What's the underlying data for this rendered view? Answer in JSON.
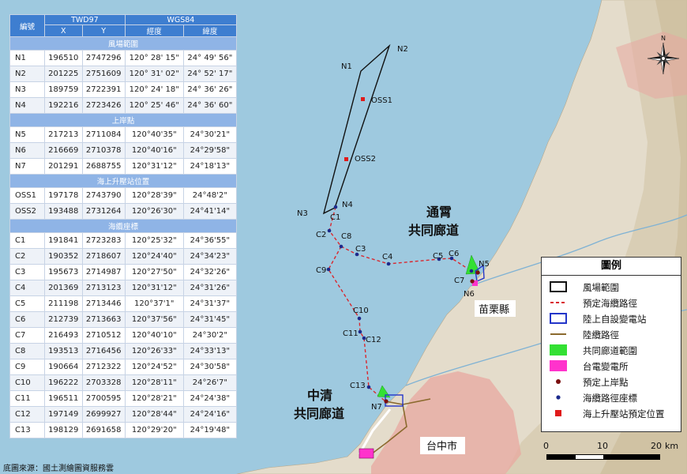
{
  "table": {
    "header": {
      "id_label": "編號",
      "twd97": "TWD97",
      "wgs84": "WGS84",
      "x": "X",
      "y": "Y",
      "lon": "經度",
      "lat": "緯度"
    },
    "sections": [
      {
        "title": "風場範圍",
        "rows": [
          {
            "id": "N1",
            "x": "196510",
            "y": "2747296",
            "lon": "120° 28' 15\"",
            "lat": "24° 49' 56\""
          },
          {
            "id": "N2",
            "x": "201225",
            "y": "2751609",
            "lon": "120° 31' 02\"",
            "lat": "24° 52' 17\""
          },
          {
            "id": "N3",
            "x": "189759",
            "y": "2722391",
            "lon": "120° 24' 18\"",
            "lat": "24° 36' 26\""
          },
          {
            "id": "N4",
            "x": "192216",
            "y": "2723426",
            "lon": "120° 25' 46\"",
            "lat": "24° 36' 60\""
          }
        ]
      },
      {
        "title": "上岸點",
        "rows": [
          {
            "id": "N5",
            "x": "217213",
            "y": "2711084",
            "lon": "120°40'35\"",
            "lat": "24°30'21\""
          },
          {
            "id": "N6",
            "x": "216669",
            "y": "2710378",
            "lon": "120°40'16\"",
            "lat": "24°29'58\""
          },
          {
            "id": "N7",
            "x": "201291",
            "y": "2688755",
            "lon": "120°31'12\"",
            "lat": "24°18'13\""
          }
        ]
      },
      {
        "title": "海上升壓站位置",
        "rows": [
          {
            "id": "OSS1",
            "x": "197178",
            "y": "2743790",
            "lon": "120°28'39\"",
            "lat": "24°48'2\""
          },
          {
            "id": "OSS2",
            "x": "193488",
            "y": "2731264",
            "lon": "120°26'30\"",
            "lat": "24°41'14\""
          }
        ]
      },
      {
        "title": "海纜座標",
        "rows": [
          {
            "id": "C1",
            "x": "191841",
            "y": "2723283",
            "lon": "120°25'32\"",
            "lat": "24°36'55\""
          },
          {
            "id": "C2",
            "x": "190352",
            "y": "2718607",
            "lon": "120°24'40\"",
            "lat": "24°34'23\""
          },
          {
            "id": "C3",
            "x": "195673",
            "y": "2714987",
            "lon": "120°27'50\"",
            "lat": "24°32'26\""
          },
          {
            "id": "C4",
            "x": "201369",
            "y": "2713123",
            "lon": "120°31'12\"",
            "lat": "24°31'26\""
          },
          {
            "id": "C5",
            "x": "211198",
            "y": "2713446",
            "lon": "120°37'1\"",
            "lat": "24°31'37\""
          },
          {
            "id": "C6",
            "x": "212739",
            "y": "2713663",
            "lon": "120°37'56\"",
            "lat": "24°31'45\""
          },
          {
            "id": "C7",
            "x": "216493",
            "y": "2710512",
            "lon": "120°40'10\"",
            "lat": "24°30'2\""
          },
          {
            "id": "C8",
            "x": "193513",
            "y": "2716456",
            "lon": "120°26'33\"",
            "lat": "24°33'13\""
          },
          {
            "id": "C9",
            "x": "190664",
            "y": "2712322",
            "lon": "120°24'52\"",
            "lat": "24°30'58\""
          },
          {
            "id": "C10",
            "x": "196222",
            "y": "2703328",
            "lon": "120°28'11\"",
            "lat": "24°26'7\""
          },
          {
            "id": "C11",
            "x": "196511",
            "y": "2700595",
            "lon": "120°28'21\"",
            "lat": "24°24'38\""
          },
          {
            "id": "C12",
            "x": "197149",
            "y": "2699927",
            "lon": "120°28'44\"",
            "lat": "24°24'16\""
          },
          {
            "id": "C13",
            "x": "198129",
            "y": "2691658",
            "lon": "120°29'20\"",
            "lat": "24°19'48\""
          }
        ]
      }
    ]
  },
  "credit": "底圖來源：國土測繪圖資服務雲",
  "map": {
    "point_labels": [
      "N1",
      "N2",
      "N3",
      "N4",
      "N5",
      "N6",
      "N7",
      "OSS1",
      "OSS2",
      "C1",
      "C2",
      "C3",
      "C4",
      "C5",
      "C6",
      "C7",
      "C8",
      "C9",
      "C10",
      "C11",
      "C12",
      "C13"
    ],
    "corridor_north": [
      "通霄",
      "共同廊道"
    ],
    "corridor_south": [
      "中清",
      "共同廊道"
    ],
    "county_label": "苗栗縣",
    "city_label": "台中市",
    "north_label": "N"
  },
  "legend": {
    "title": "圖例",
    "items": [
      {
        "label": "風場範圍",
        "symbol": "wind-farm-outline"
      },
      {
        "label": "預定海纜路徑",
        "symbol": "dashed-red-line"
      },
      {
        "label": "陸上自設變電站",
        "symbol": "blue-outline"
      },
      {
        "label": "陸纜路徑",
        "symbol": "brown-line"
      },
      {
        "label": "共同廊道範圍",
        "symbol": "green-fill"
      },
      {
        "label": "台電變電所",
        "symbol": "magenta-fill"
      },
      {
        "label": "預定上岸點",
        "symbol": "dark-red-dot"
      },
      {
        "label": "海纜路徑座標",
        "symbol": "navy-dot"
      },
      {
        "label": "海上升壓站預定位置",
        "symbol": "red-square"
      }
    ]
  },
  "scale_bar": {
    "ticks": [
      "0",
      "10",
      "20"
    ],
    "unit": "km"
  },
  "colors": {
    "sea": "#9ec9df",
    "land": "#e4dccb",
    "table_header": "#3e7ed0",
    "table_section": "#8fb4e6",
    "cable_route": "#d9272e",
    "cable_point": "#1c2a8c",
    "corridor": "#33e033",
    "substation_taipower": "#ff33cc",
    "land_cable": "#8b6a2e"
  }
}
